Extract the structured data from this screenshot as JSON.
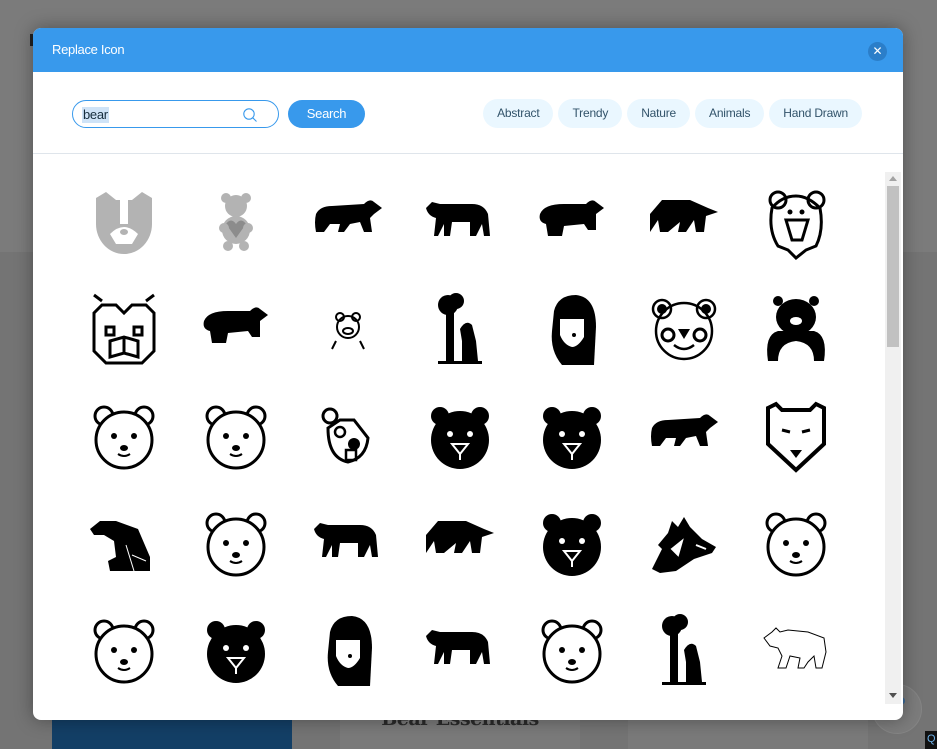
{
  "background": {
    "card_title": "Bear Essentials",
    "help_symbol": "?",
    "corner_symbol": "Q"
  },
  "dialog": {
    "title": "Replace Icon",
    "close_symbol": "✕",
    "search": {
      "value": "bear",
      "placeholder": "",
      "button_label": "Search"
    },
    "categories": [
      "Abstract",
      "Trendy",
      "Nature",
      "Animals",
      "Hand Drawn"
    ],
    "icons": [
      {
        "name": "bear-face-gray-icon",
        "kind": "gray-face"
      },
      {
        "name": "teddy-bear-heart-icon",
        "kind": "teddy"
      },
      {
        "name": "bear-walking-silhouette-icon",
        "kind": "walk"
      },
      {
        "name": "bear-standing-silhouette-icon",
        "kind": "walk2"
      },
      {
        "name": "bear-chubby-silhouette-icon",
        "kind": "walk3"
      },
      {
        "name": "bear-geometric-silhouette-icon",
        "kind": "geo"
      },
      {
        "name": "lion-bear-sketch-icon",
        "kind": "roar"
      },
      {
        "name": "bear-face-geometric-outline-icon",
        "kind": "geoface"
      },
      {
        "name": "bear-round-silhouette-icon",
        "kind": "walk3"
      },
      {
        "name": "bear-small-outline-icon",
        "kind": "small-outline"
      },
      {
        "name": "bear-tree-silhouette-icon",
        "kind": "tree"
      },
      {
        "name": "polar-bear-portrait-icon",
        "kind": "portrait"
      },
      {
        "name": "panda-face-outline-icon",
        "kind": "panda"
      },
      {
        "name": "bear-hug-silhouette-icon",
        "kind": "hug"
      },
      {
        "name": "angry-bear-face-icon",
        "kind": "outline-face"
      },
      {
        "name": "cute-bear-face-icon",
        "kind": "outline-face"
      },
      {
        "name": "beaver-bear-face-icon",
        "kind": "beaver"
      },
      {
        "name": "bear-face-black-eyes-icon",
        "kind": "black-face"
      },
      {
        "name": "bear-face-black-nose-icon",
        "kind": "black-face"
      },
      {
        "name": "bear-cub-silhouette-icon",
        "kind": "walk"
      },
      {
        "name": "bear-shield-face-icon",
        "kind": "shield"
      },
      {
        "name": "polar-bear-sitting-icon",
        "kind": "sit"
      },
      {
        "name": "bear-face-y-nose-outline-icon",
        "kind": "outline-face"
      },
      {
        "name": "grizzly-bear-walking-icon",
        "kind": "walk2"
      },
      {
        "name": "bear-low-poly-icon",
        "kind": "geo"
      },
      {
        "name": "bear-face-y-nose-black-icon",
        "kind": "black-face"
      },
      {
        "name": "bear-head-sketch-icon",
        "kind": "sketch-head"
      },
      {
        "name": "bear-face-round-outline-icon",
        "kind": "outline-face"
      },
      {
        "name": "polar-bear-face-thin-icon",
        "kind": "outline-face"
      },
      {
        "name": "bear-face-o-mouth-icon",
        "kind": "black-face"
      },
      {
        "name": "moon-bear-standing-icon",
        "kind": "portrait"
      },
      {
        "name": "bear-prowling-silhouette-icon",
        "kind": "walk2"
      },
      {
        "name": "serious-bear-face-icon",
        "kind": "outline-face"
      },
      {
        "name": "bear-strawberry-tree-icon",
        "kind": "tree"
      },
      {
        "name": "bear-line-drawing-icon",
        "kind": "line-walk"
      }
    ]
  },
  "scrollbar": {
    "position_fraction": 0.0,
    "visible_fraction": 0.32
  }
}
